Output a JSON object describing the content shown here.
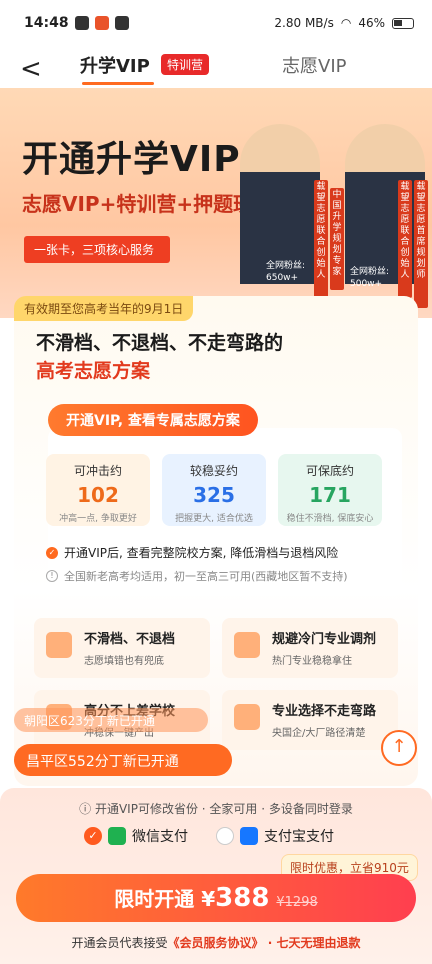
{
  "status_bar": {
    "time": "14:48",
    "network_speed": "2.80 MB/s",
    "battery": "46%"
  },
  "nav": {
    "back_label": "<",
    "tab_active": "升学VIP",
    "tab_badge": "特训营",
    "tab_inactive": "志愿VIP"
  },
  "hero": {
    "title": "开通升学VIP",
    "subtitle": "志愿VIP+特训营+押题班",
    "pill": "一张卡，三项核心服务",
    "person1": {
      "tag": "载望志愿联合创始人",
      "fans_label": "全网粉丝:",
      "fans": "650w+"
    },
    "person2": {
      "tag": "中国升学规划专家",
      "fans_label": "全网粉丝:",
      "fans": "500w+",
      "tag2": "载望志愿联合创始人",
      "tag3": "载望志愿首席规划师"
    }
  },
  "card": {
    "validity": "有效期至您高考当年的9月1日",
    "headline1": "不滑档、不退档、不走弯路的",
    "headline2": "高考志愿方案",
    "promo": "开通VIP, 查看专属志愿方案",
    "stats": [
      {
        "label": "可冲击约",
        "value": "102",
        "note": "冲高一点, 争取更好"
      },
      {
        "label": "较稳妥约",
        "value": "325",
        "note": "把握更大, 适合优选"
      },
      {
        "label": "可保底约",
        "value": "171",
        "note": "稳住不滑档, 保底安心"
      }
    ],
    "check_text": "开通VIP后, 查看完整院校方案, 降低滑档与退档风险",
    "info_text": "全国新老高考均适用，初一至高三可用(西藏地区暂不支持)",
    "features": [
      {
        "title": "不滑档、不退档",
        "desc": "志愿填错也有兜底"
      },
      {
        "title": "规避冷门专业调剂",
        "desc": "热门专业稳稳拿住"
      },
      {
        "title": "高分不上差学校",
        "desc": "冲稳保一键产出"
      },
      {
        "title": "专业选择不走弯路",
        "desc": "央国企/大厂路径清楚"
      }
    ]
  },
  "toasts": {
    "t1": "朝阳区623分丁新已开通",
    "t2": "昌平区552分丁新已开通"
  },
  "bottom": {
    "notice": "开通VIP可修改省份 · 全家可用 · 多设备同时登录",
    "pay_wechat": "微信支付",
    "pay_alipay": "支付宝支付",
    "discount_tip": "限时优惠，立省910元",
    "buy_label": "限时开通 ¥",
    "buy_price": "388",
    "buy_old": "¥1298",
    "terms_prefix": "开通会员代表接受",
    "terms_link": "《会员服务协议》",
    "terms_suffix": " · 七天无理由退款"
  }
}
